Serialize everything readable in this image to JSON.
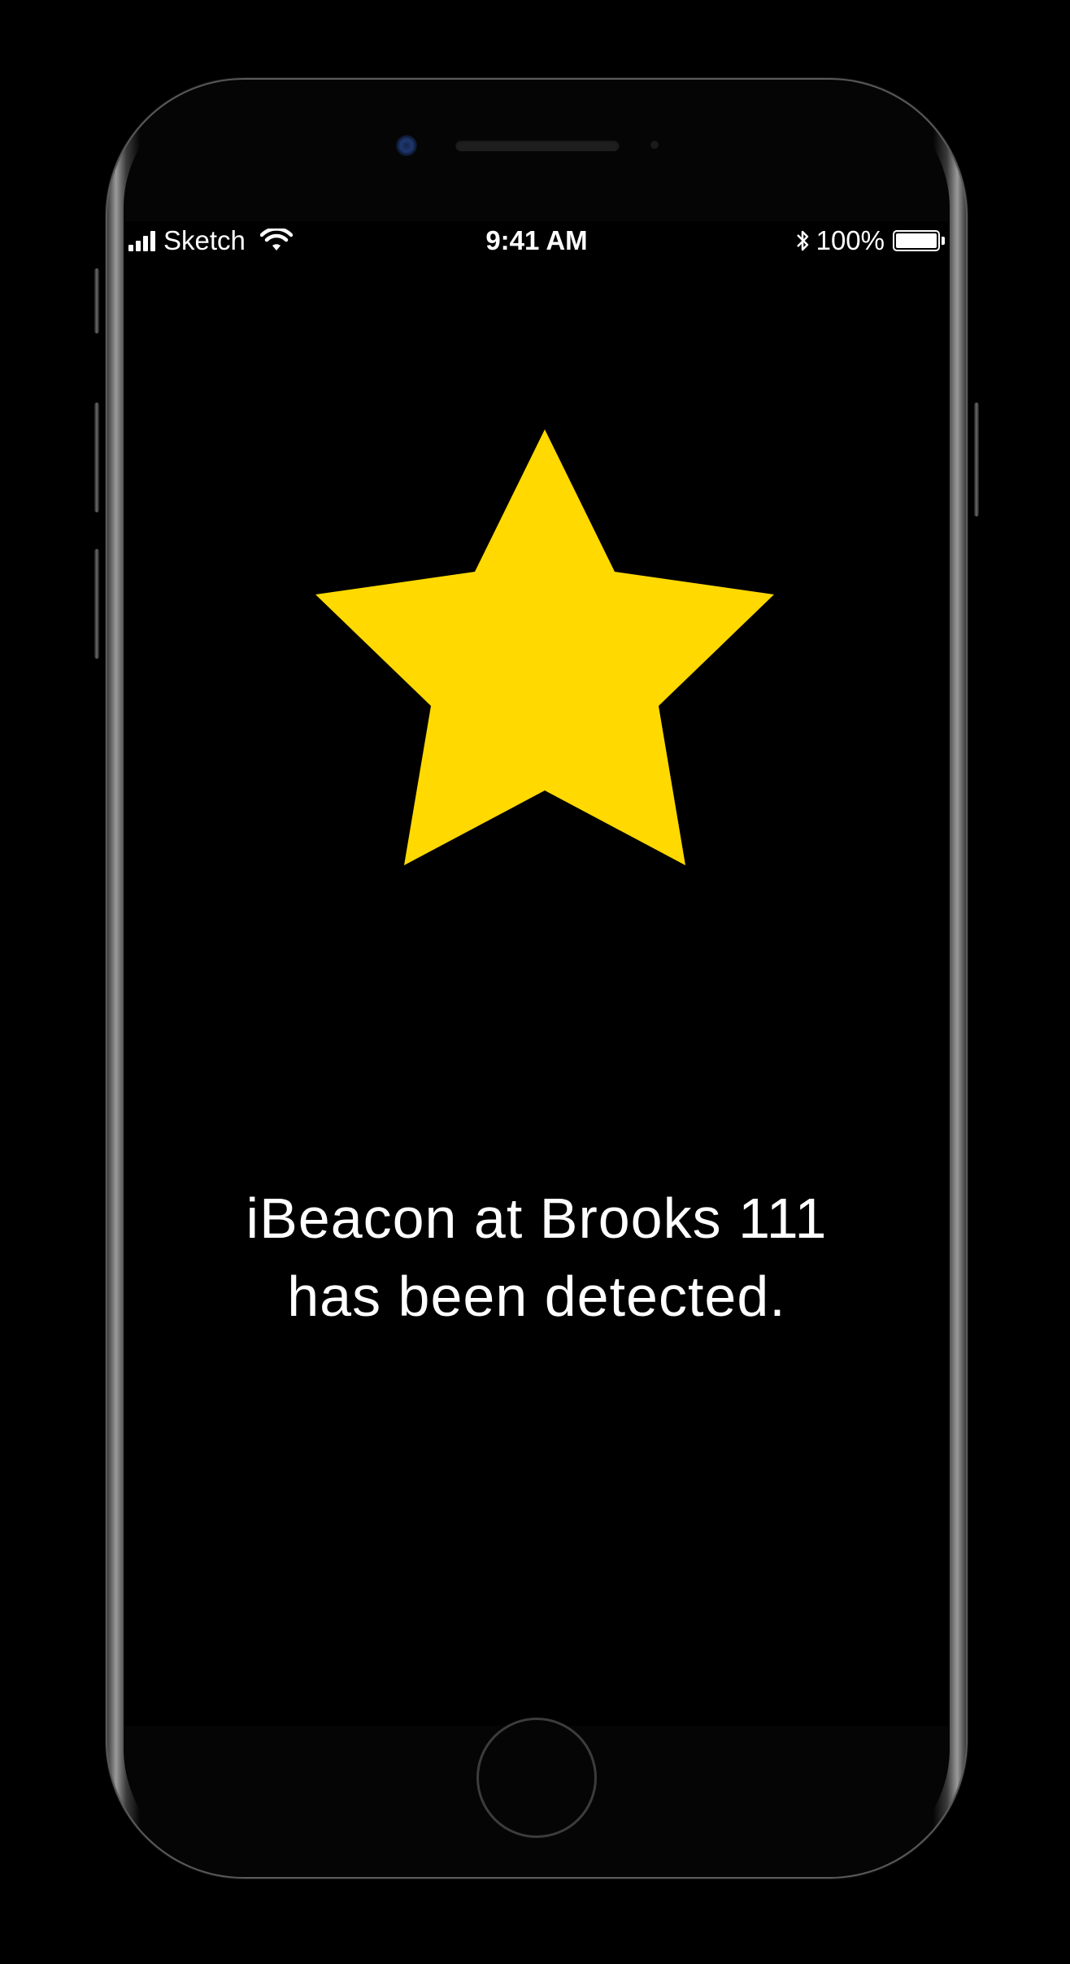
{
  "status_bar": {
    "carrier": "Sketch",
    "time": "9:41 AM",
    "battery_percent": "100%",
    "battery_level": 1.0,
    "signal_icon": "signal-bars-icon",
    "wifi_icon": "wifi-icon",
    "bluetooth_icon": "bluetooth-icon",
    "bluetooth_glyph": "✱"
  },
  "main": {
    "star_icon": "star-icon",
    "star_color": "#FFD900",
    "message_line1": "iBeacon at Brooks 111",
    "message_line2": "has been detected."
  },
  "device": {
    "home_button_icon": "home-button"
  }
}
